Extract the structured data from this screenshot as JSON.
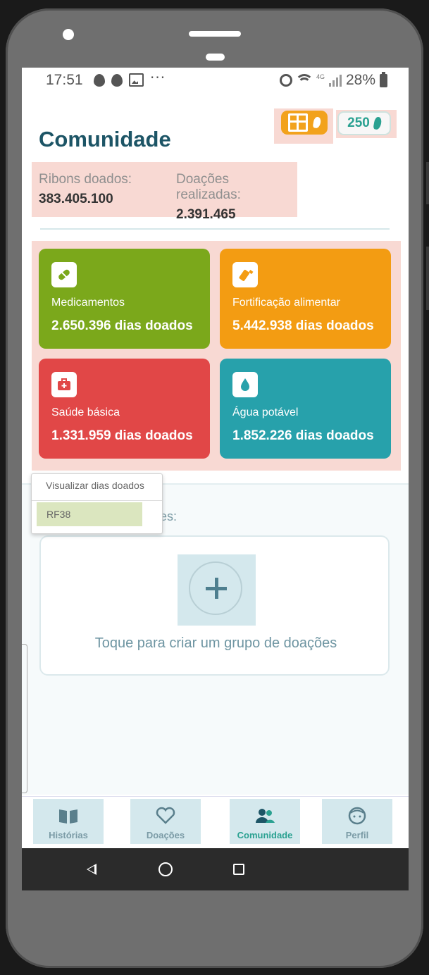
{
  "status_bar": {
    "time": "17:51",
    "network": "4G",
    "battery": "28%",
    "overflow": "···"
  },
  "header": {
    "title": "Comunidade",
    "ribbon_count": "250"
  },
  "stats": {
    "ribbons_label": "Ribons doados:",
    "ribbons_value": "383.405.100",
    "donations_label": "Doações realizadas:",
    "donations_value": "2.391.465"
  },
  "cards": [
    {
      "label": "Medicamentos",
      "value": "2.650.396 dias doados",
      "color": "#7ba81b",
      "icon": "pill-icon"
    },
    {
      "label": "Fortificação alimentar",
      "value": "5.442.938 dias doados",
      "color": "#f39c12",
      "icon": "bottle-icon"
    },
    {
      "label": "Saúde básica",
      "value": "1.331.959 dias doados",
      "color": "#e14747",
      "icon": "first-aid-kit-icon"
    },
    {
      "label": "Água potável",
      "value": "1.852.226 dias doados",
      "color": "#27a1ab",
      "icon": "water-drop-icon"
    }
  ],
  "menu": {
    "item1": "Visualizar dias doados",
    "item2": "RF38"
  },
  "groups": {
    "label_fragment": "es:",
    "create_text": "Toque para criar um grupo de doações"
  },
  "bottom_nav": [
    {
      "label": "Histórias",
      "icon": "book-icon"
    },
    {
      "label": "Doações",
      "icon": "heart-icon"
    },
    {
      "label": "Comunidade",
      "icon": "people-icon",
      "active": true
    },
    {
      "label": "Perfil",
      "icon": "face-icon"
    }
  ],
  "colors": {
    "accent": "#2aa191",
    "title": "#1d5566",
    "gift": "#f2a21c"
  }
}
